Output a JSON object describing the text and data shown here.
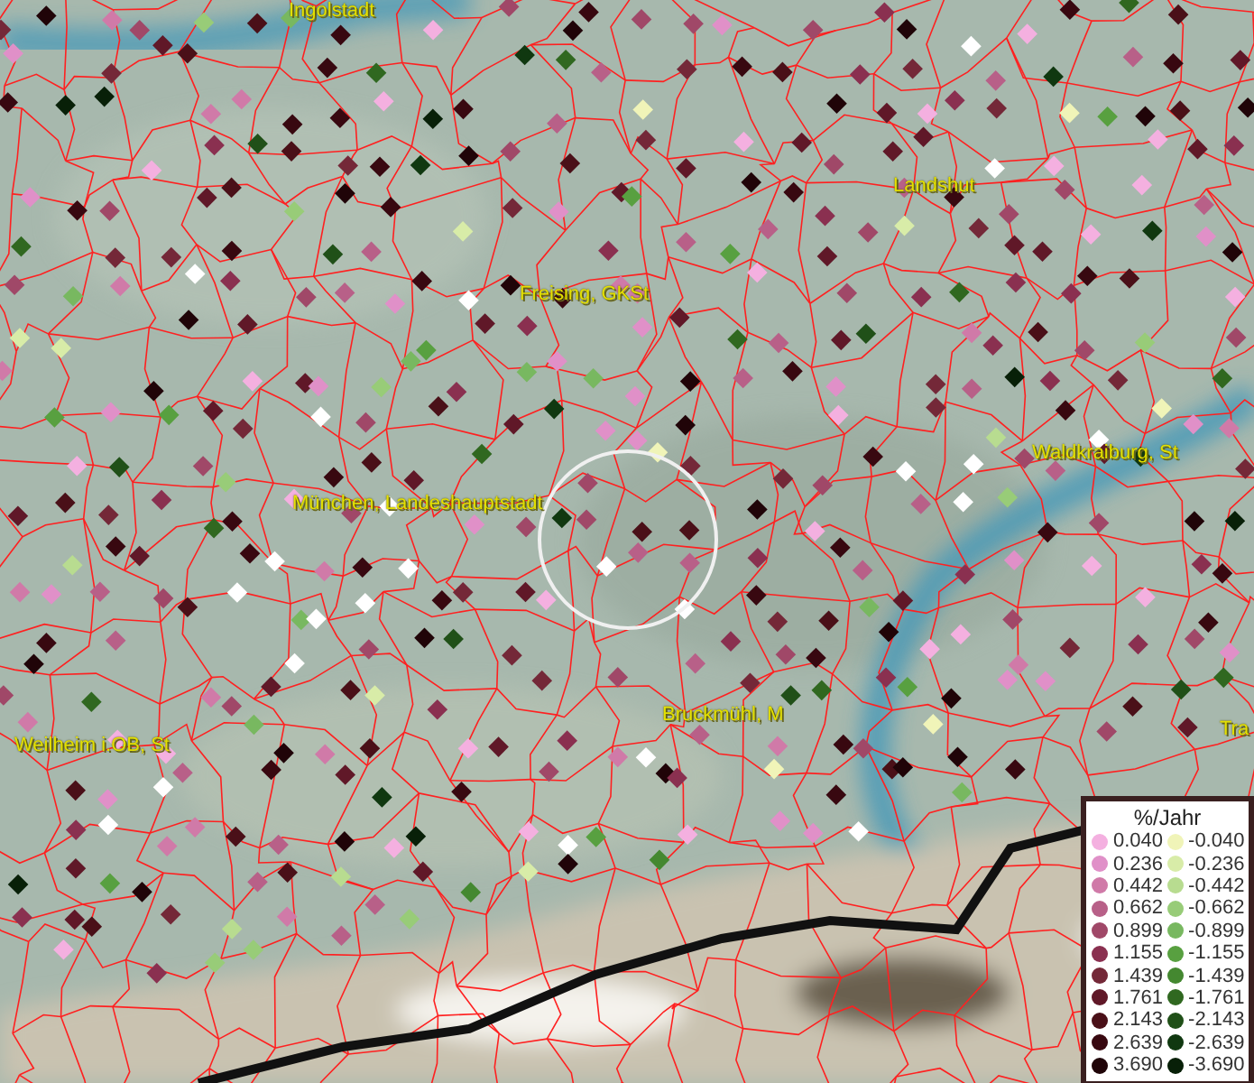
{
  "map": {
    "places": [
      {
        "name": "Ingolstadt"
      },
      {
        "name": "Landshut"
      },
      {
        "name": "Freising, GKSt"
      },
      {
        "name": "München, Landeshauptstadt"
      },
      {
        "name": "Waldkraiburg, St"
      },
      {
        "name": "Weilheim i.OB, St"
      },
      {
        "name": "Bruckmühl, M"
      },
      {
        "name": "Tra"
      }
    ]
  },
  "legend": {
    "title": "%/Jahr",
    "columns": [
      [
        {
          "value": "0.040",
          "color": "#f4b0e0"
        },
        {
          "value": "0.236",
          "color": "#e090c8"
        },
        {
          "value": "0.442",
          "color": "#d07aa8"
        },
        {
          "value": "0.662",
          "color": "#b86088"
        },
        {
          "value": "0.899",
          "color": "#a04868"
        },
        {
          "value": "1.155",
          "color": "#8a3050"
        },
        {
          "value": "1.439",
          "color": "#742838"
        },
        {
          "value": "1.761",
          "color": "#601828"
        },
        {
          "value": "2.143",
          "color": "#4a1018"
        },
        {
          "value": "2.639",
          "color": "#380810"
        },
        {
          "value": "3.690",
          "color": "#200408"
        }
      ],
      [
        {
          "value": "-0.040",
          "color": "#f0f4b8"
        },
        {
          "value": "-0.236",
          "color": "#d8eca8"
        },
        {
          "value": "-0.442",
          "color": "#b8dc90"
        },
        {
          "value": "-0.662",
          "color": "#98cc78"
        },
        {
          "value": "-0.899",
          "color": "#78b860"
        },
        {
          "value": "-1.155",
          "color": "#58a040"
        },
        {
          "value": "-1.439",
          "color": "#448830"
        },
        {
          "value": "-1.761",
          "color": "#306820"
        },
        {
          "value": "-2.143",
          "color": "#205018"
        },
        {
          "value": "-2.639",
          "color": "#103810"
        },
        {
          "value": "-3.690",
          "color": "#082008"
        }
      ]
    ]
  }
}
